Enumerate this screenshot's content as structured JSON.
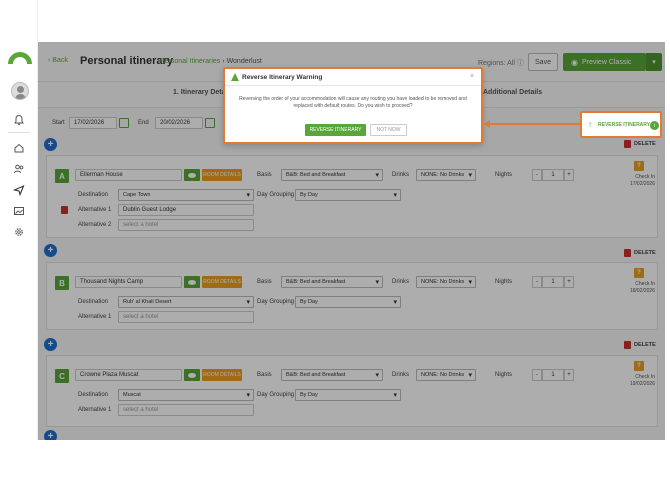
{
  "nav": {
    "back": "‹ Back",
    "title": "Personal itinerary",
    "crumb1": "Personal Itineraries",
    "crumb_sep": "›",
    "crumb2": "Wonderlust",
    "regions": "Regions: All ⓘ",
    "save": "Save",
    "preview": "Preview Classic",
    "preview_caret": "▾"
  },
  "steps": {
    "step1": "1. Itinerary Details",
    "step3": "Additional Details"
  },
  "dates": {
    "start_label": "Start",
    "start_value": "17/02/2026",
    "end_label": "End",
    "end_value": "20/02/2026"
  },
  "labels": {
    "basis": "Basis",
    "drinks": "Drinks",
    "nights": "Nights",
    "destination": "Destination",
    "day_grouping": "Day Grouping",
    "alt1": "Alternative 1",
    "alt2": "Alternative 2",
    "room_details": "ROOM DETAILS",
    "delete": "DELETE",
    "select_hotel": "select a hotel",
    "check_in": "Check In",
    "stepper_minus": "-",
    "stepper_plus": "+",
    "q": "?"
  },
  "stops": [
    {
      "letter": "A",
      "hotel": "Ellerman House",
      "basis": "B&B: Bed and Breakfast",
      "drinks": "NONE: No Drinks",
      "nights": "1",
      "destination": "Cape Town",
      "day_grouping": "By Day",
      "alt1": "Dublin Guest Lodge",
      "checkin_date": "17/02/2026"
    },
    {
      "letter": "B",
      "hotel": "Thousand Nights Camp",
      "basis": "B&B: Bed and Breakfast",
      "drinks": "NONE: No Drinks",
      "nights": "1",
      "destination": "Rub' al Khali Desert",
      "day_grouping": "By Day",
      "checkin_date": "18/02/2026"
    },
    {
      "letter": "C",
      "hotel": "Crowne Plaza Muscat",
      "basis": "B&B: Bed and Breakfast",
      "drinks": "NONE: No Drinks",
      "nights": "1",
      "destination": "Muscat",
      "day_grouping": "By Day",
      "checkin_date": "19/02/2026"
    }
  ],
  "modal": {
    "title": "Reverse Itinerary Warning",
    "close": "×",
    "message": "Reversing the order of your accommodation will cause any routing you have loaded to be removed and replaced with default routes. Do you wish to proceed?",
    "confirm": "REVERSE ITINERARY",
    "cancel": "NOT NOW"
  },
  "reverse_button": {
    "arrow": "↑",
    "label": "REVERSE ITINERARY",
    "info": "i"
  },
  "colors": {
    "accent": "#5aa63a",
    "highlight": "#e07a34",
    "plus_blue": "#1f6fd1",
    "room_orange": "#e8a020",
    "delete_red": "#c9302c"
  }
}
